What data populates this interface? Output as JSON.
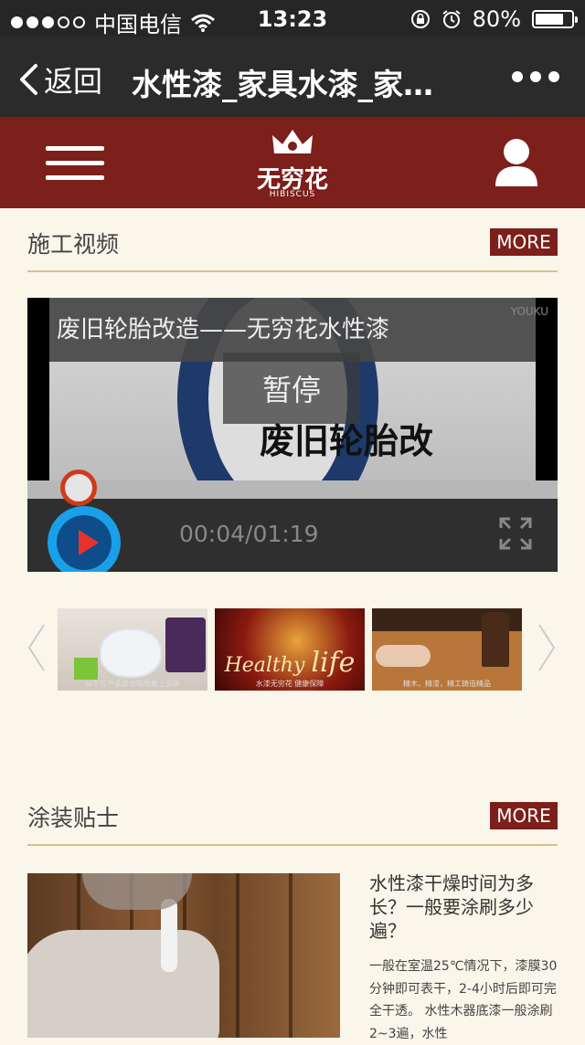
{
  "status_bar": {
    "carrier": "中国电信",
    "time": "13:23",
    "battery_percent": "80%",
    "battery_level": 0.8,
    "signal_bars": 3
  },
  "nav": {
    "back_label": "返回",
    "title": "水性漆_家具水漆_家…"
  },
  "header": {
    "brand_name": "无穷花",
    "brand_sub": "HIBISCUS",
    "accent_color": "#7d1f1b"
  },
  "video_section": {
    "title": "施工视频",
    "more_label": "MORE",
    "player": {
      "caption": "废旧轮胎改造——无穷花水性漆",
      "watermark": "YOUKU",
      "pause_label": "暂停",
      "banner_text": "废旧轮胎改",
      "time": "00:04/01:19",
      "progress": 0.05
    },
    "thumbnails": [
      {
        "caption": "从不在产品安全和质量上妥协"
      },
      {
        "caption": "水漆无穷花 健康保障"
      },
      {
        "caption": "精木，精漆，精工铸造精品"
      }
    ]
  },
  "tips_section": {
    "title": "涂装贴士",
    "more_label": "MORE",
    "article": {
      "title": "水性漆干燥时间为多长？一般要涂刷多少遍？",
      "body": "一般在室温25℃情况下，漆膜30分钟即可表干，2-4小时后即可完全干透。 水性木器底漆一般涂刷2~3遍，水性"
    }
  }
}
